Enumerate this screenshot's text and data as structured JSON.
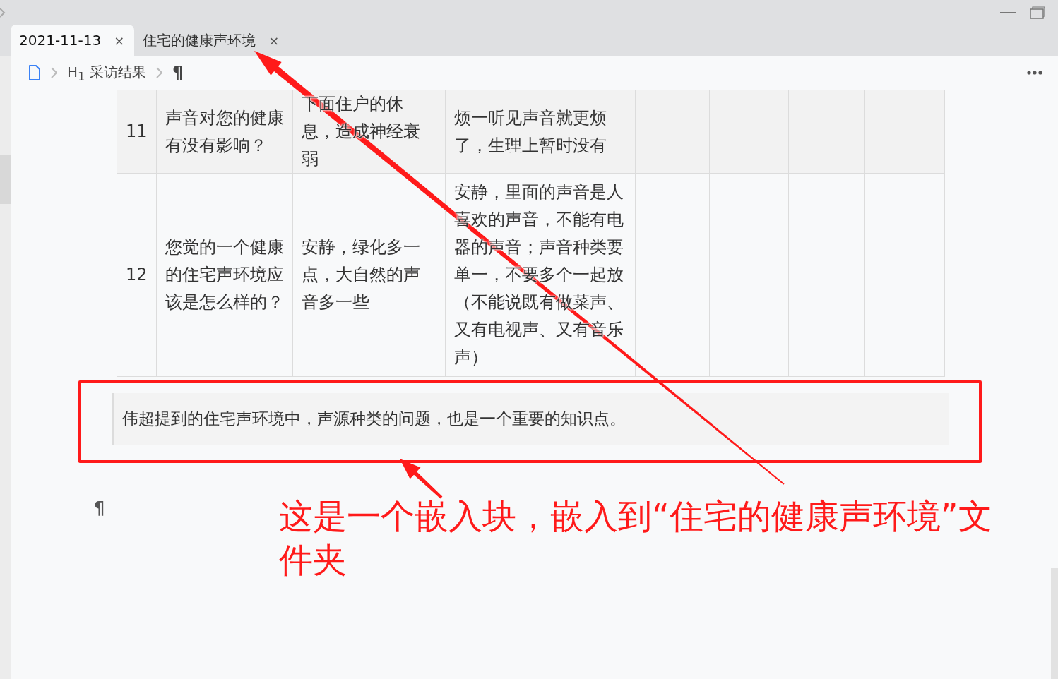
{
  "tabs": [
    {
      "label": "2021-11-13",
      "selected": true,
      "close": "×"
    },
    {
      "label": "住宅的健康声环境",
      "selected": false,
      "close": "×"
    }
  ],
  "breadcrumb": [
    {
      "kind": "file"
    },
    {
      "kind": "heading",
      "tag": "H$_{1}$",
      "label": "采访结果"
    },
    {
      "kind": "paragraph",
      "label": "¶"
    }
  ],
  "table": {
    "rows": [
      {
        "cells": [
          "11",
          "声音对您的健康有没有影响？",
          "下面住户的休息，造成神经衰弱",
          "烦一听见声音就更烦了，生理上暂时没有"
        ]
      },
      {
        "cells": [
          "12",
          "您觉的一个健康的住宅声环境应该是怎么样的？",
          "安静，绿化多一点，大自然的声音多一些",
          "安静，里面的声音是人喜欢的声音，不能有电器的声音；声音种类要单一，不要多个一起放（不能说既有做菜声、又有电视声、又有音乐声）"
        ]
      }
    ]
  },
  "embed_block": {
    "text": "伟超提到的住宅声环境中，声源种类的问题，也是一个重要的知识点。"
  },
  "end_mark": "¶",
  "annotation": {
    "text": "这是一个嵌入块，嵌入到“住宅的健康声环境”文件夹"
  }
}
